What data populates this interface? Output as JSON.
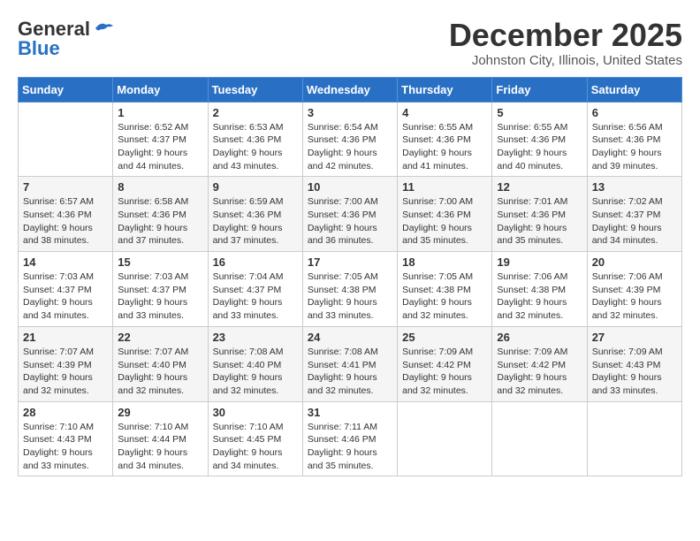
{
  "header": {
    "logo_general": "General",
    "logo_blue": "Blue",
    "month_title": "December 2025",
    "location": "Johnston City, Illinois, United States"
  },
  "weekdays": [
    "Sunday",
    "Monday",
    "Tuesday",
    "Wednesday",
    "Thursday",
    "Friday",
    "Saturday"
  ],
  "weeks": [
    [
      {
        "day": "",
        "sunrise": "",
        "sunset": "",
        "daylight": ""
      },
      {
        "day": "1",
        "sunrise": "Sunrise: 6:52 AM",
        "sunset": "Sunset: 4:37 PM",
        "daylight": "Daylight: 9 hours and 44 minutes."
      },
      {
        "day": "2",
        "sunrise": "Sunrise: 6:53 AM",
        "sunset": "Sunset: 4:36 PM",
        "daylight": "Daylight: 9 hours and 43 minutes."
      },
      {
        "day": "3",
        "sunrise": "Sunrise: 6:54 AM",
        "sunset": "Sunset: 4:36 PM",
        "daylight": "Daylight: 9 hours and 42 minutes."
      },
      {
        "day": "4",
        "sunrise": "Sunrise: 6:55 AM",
        "sunset": "Sunset: 4:36 PM",
        "daylight": "Daylight: 9 hours and 41 minutes."
      },
      {
        "day": "5",
        "sunrise": "Sunrise: 6:55 AM",
        "sunset": "Sunset: 4:36 PM",
        "daylight": "Daylight: 9 hours and 40 minutes."
      },
      {
        "day": "6",
        "sunrise": "Sunrise: 6:56 AM",
        "sunset": "Sunset: 4:36 PM",
        "daylight": "Daylight: 9 hours and 39 minutes."
      }
    ],
    [
      {
        "day": "7",
        "sunrise": "Sunrise: 6:57 AM",
        "sunset": "Sunset: 4:36 PM",
        "daylight": "Daylight: 9 hours and 38 minutes."
      },
      {
        "day": "8",
        "sunrise": "Sunrise: 6:58 AM",
        "sunset": "Sunset: 4:36 PM",
        "daylight": "Daylight: 9 hours and 37 minutes."
      },
      {
        "day": "9",
        "sunrise": "Sunrise: 6:59 AM",
        "sunset": "Sunset: 4:36 PM",
        "daylight": "Daylight: 9 hours and 37 minutes."
      },
      {
        "day": "10",
        "sunrise": "Sunrise: 7:00 AM",
        "sunset": "Sunset: 4:36 PM",
        "daylight": "Daylight: 9 hours and 36 minutes."
      },
      {
        "day": "11",
        "sunrise": "Sunrise: 7:00 AM",
        "sunset": "Sunset: 4:36 PM",
        "daylight": "Daylight: 9 hours and 35 minutes."
      },
      {
        "day": "12",
        "sunrise": "Sunrise: 7:01 AM",
        "sunset": "Sunset: 4:36 PM",
        "daylight": "Daylight: 9 hours and 35 minutes."
      },
      {
        "day": "13",
        "sunrise": "Sunrise: 7:02 AM",
        "sunset": "Sunset: 4:37 PM",
        "daylight": "Daylight: 9 hours and 34 minutes."
      }
    ],
    [
      {
        "day": "14",
        "sunrise": "Sunrise: 7:03 AM",
        "sunset": "Sunset: 4:37 PM",
        "daylight": "Daylight: 9 hours and 34 minutes."
      },
      {
        "day": "15",
        "sunrise": "Sunrise: 7:03 AM",
        "sunset": "Sunset: 4:37 PM",
        "daylight": "Daylight: 9 hours and 33 minutes."
      },
      {
        "day": "16",
        "sunrise": "Sunrise: 7:04 AM",
        "sunset": "Sunset: 4:37 PM",
        "daylight": "Daylight: 9 hours and 33 minutes."
      },
      {
        "day": "17",
        "sunrise": "Sunrise: 7:05 AM",
        "sunset": "Sunset: 4:38 PM",
        "daylight": "Daylight: 9 hours and 33 minutes."
      },
      {
        "day": "18",
        "sunrise": "Sunrise: 7:05 AM",
        "sunset": "Sunset: 4:38 PM",
        "daylight": "Daylight: 9 hours and 32 minutes."
      },
      {
        "day": "19",
        "sunrise": "Sunrise: 7:06 AM",
        "sunset": "Sunset: 4:38 PM",
        "daylight": "Daylight: 9 hours and 32 minutes."
      },
      {
        "day": "20",
        "sunrise": "Sunrise: 7:06 AM",
        "sunset": "Sunset: 4:39 PM",
        "daylight": "Daylight: 9 hours and 32 minutes."
      }
    ],
    [
      {
        "day": "21",
        "sunrise": "Sunrise: 7:07 AM",
        "sunset": "Sunset: 4:39 PM",
        "daylight": "Daylight: 9 hours and 32 minutes."
      },
      {
        "day": "22",
        "sunrise": "Sunrise: 7:07 AM",
        "sunset": "Sunset: 4:40 PM",
        "daylight": "Daylight: 9 hours and 32 minutes."
      },
      {
        "day": "23",
        "sunrise": "Sunrise: 7:08 AM",
        "sunset": "Sunset: 4:40 PM",
        "daylight": "Daylight: 9 hours and 32 minutes."
      },
      {
        "day": "24",
        "sunrise": "Sunrise: 7:08 AM",
        "sunset": "Sunset: 4:41 PM",
        "daylight": "Daylight: 9 hours and 32 minutes."
      },
      {
        "day": "25",
        "sunrise": "Sunrise: 7:09 AM",
        "sunset": "Sunset: 4:42 PM",
        "daylight": "Daylight: 9 hours and 32 minutes."
      },
      {
        "day": "26",
        "sunrise": "Sunrise: 7:09 AM",
        "sunset": "Sunset: 4:42 PM",
        "daylight": "Daylight: 9 hours and 32 minutes."
      },
      {
        "day": "27",
        "sunrise": "Sunrise: 7:09 AM",
        "sunset": "Sunset: 4:43 PM",
        "daylight": "Daylight: 9 hours and 33 minutes."
      }
    ],
    [
      {
        "day": "28",
        "sunrise": "Sunrise: 7:10 AM",
        "sunset": "Sunset: 4:43 PM",
        "daylight": "Daylight: 9 hours and 33 minutes."
      },
      {
        "day": "29",
        "sunrise": "Sunrise: 7:10 AM",
        "sunset": "Sunset: 4:44 PM",
        "daylight": "Daylight: 9 hours and 34 minutes."
      },
      {
        "day": "30",
        "sunrise": "Sunrise: 7:10 AM",
        "sunset": "Sunset: 4:45 PM",
        "daylight": "Daylight: 9 hours and 34 minutes."
      },
      {
        "day": "31",
        "sunrise": "Sunrise: 7:11 AM",
        "sunset": "Sunset: 4:46 PM",
        "daylight": "Daylight: 9 hours and 35 minutes."
      },
      {
        "day": "",
        "sunrise": "",
        "sunset": "",
        "daylight": ""
      },
      {
        "day": "",
        "sunrise": "",
        "sunset": "",
        "daylight": ""
      },
      {
        "day": "",
        "sunrise": "",
        "sunset": "",
        "daylight": ""
      }
    ]
  ]
}
